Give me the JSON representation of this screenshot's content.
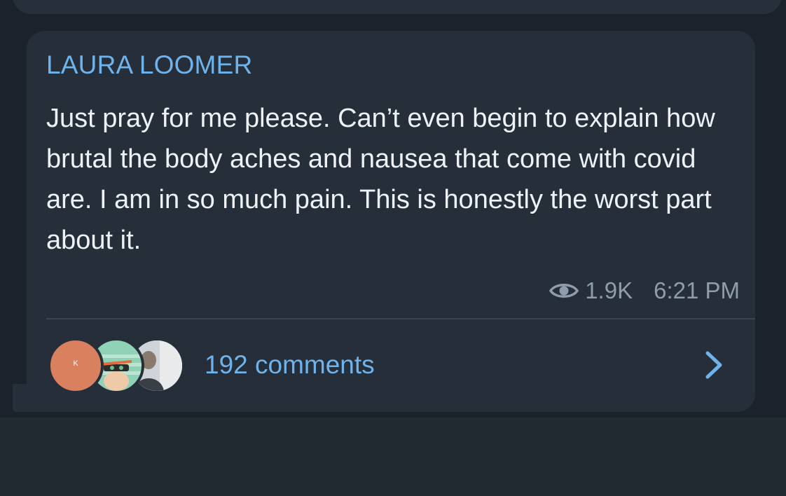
{
  "post": {
    "author": "LAURA LOOMER",
    "text": "Just pray for me please. Can’t even begin to explain how brutal the body aches and nausea that come with covid are. I am in so much pain. This is honestly the worst part about it.",
    "views": "1.9K",
    "time": "6:21 PM",
    "view_icon": "eye-icon"
  },
  "comments": {
    "label": "192 comments",
    "avatar_initial": "K",
    "chevron_icon": "chevron-right-icon"
  },
  "colors": {
    "accent": "#6eb3ec",
    "bubble": "#252e39",
    "background": "#1b222b",
    "text": "#eef2f6",
    "meta": "#8e9cab"
  }
}
